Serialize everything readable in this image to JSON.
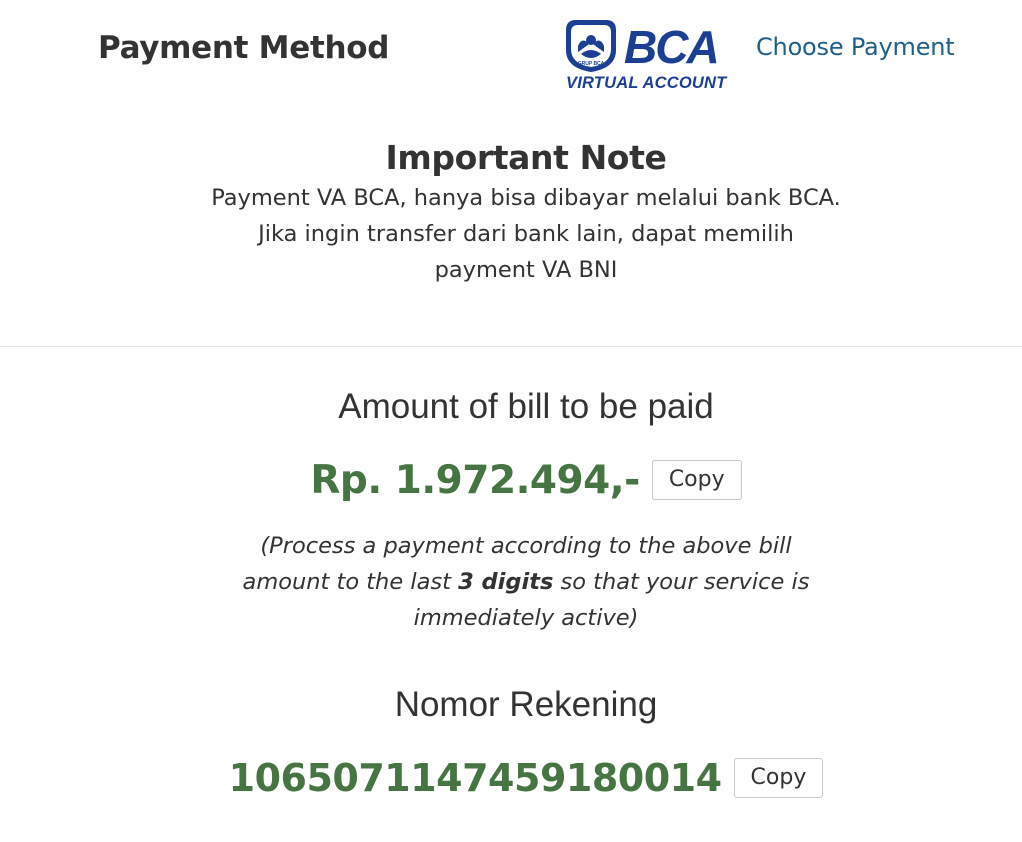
{
  "header": {
    "title": "Payment Method",
    "logo": {
      "name": "BCA",
      "subtitle": "VIRTUAL ACCOUNT",
      "group_label": "GRUP BCA",
      "color": "#1c3f94"
    },
    "choose_payment_label": "Choose Payment"
  },
  "note": {
    "title": "Important Note",
    "body": "Payment VA BCA, hanya bisa dibayar melalui bank BCA. Jika ingin transfer dari bank lain, dapat memilih payment VA BNI"
  },
  "amount": {
    "heading": "Amount of bill to be paid",
    "value": "Rp. 1.972.494,-",
    "copy_label": "Copy",
    "instruction_prefix": "(Process a payment according to the above bill amount to the last ",
    "instruction_bold": "3 digits",
    "instruction_suffix": " so that your service is immediately active)"
  },
  "account": {
    "heading": "Nomor Rekening",
    "value": "1065071147459180014",
    "copy_label": "Copy"
  },
  "colors": {
    "accent_green": "#467442",
    "link_blue": "#1f5f8b",
    "text": "#333333"
  }
}
